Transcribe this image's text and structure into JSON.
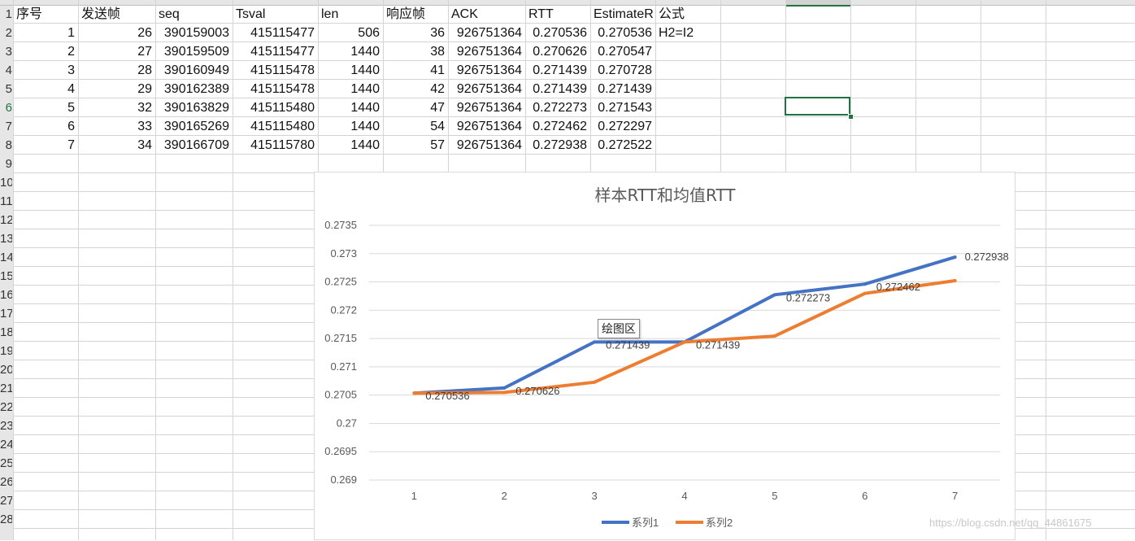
{
  "spreadsheet": {
    "row_numbers": [
      "1",
      "2",
      "3",
      "4",
      "5",
      "6",
      "7",
      "8",
      "9",
      "10",
      "11",
      "12",
      "13",
      "14",
      "15",
      "16",
      "17",
      "18",
      "19",
      "20",
      "21",
      "22",
      "23",
      "24",
      "25",
      "26",
      "27",
      "28"
    ],
    "selected_row": "6",
    "headers": [
      "序号",
      "发送帧",
      "seq",
      "Tsval",
      "len",
      "响应帧",
      "ACK",
      "RTT",
      "EstimateR",
      "公式"
    ],
    "rows": [
      [
        "1",
        "26",
        "390159003",
        "415115477",
        "506",
        "36",
        "926751364",
        "0.270536",
        "0.270536",
        "H2=I2"
      ],
      [
        "2",
        "27",
        "390159509",
        "415115477",
        "1440",
        "38",
        "926751364",
        "0.270626",
        "0.270547",
        ""
      ],
      [
        "3",
        "28",
        "390160949",
        "415115478",
        "1440",
        "41",
        "926751364",
        "0.271439",
        "0.270728",
        ""
      ],
      [
        "4",
        "29",
        "390162389",
        "415115478",
        "1440",
        "42",
        "926751364",
        "0.271439",
        "0.271439",
        ""
      ],
      [
        "5",
        "32",
        "390163829",
        "415115480",
        "1440",
        "47",
        "926751364",
        "0.272273",
        "0.271543",
        ""
      ],
      [
        "6",
        "33",
        "390165269",
        "415115480",
        "1440",
        "54",
        "926751364",
        "0.272462",
        "0.272297",
        ""
      ],
      [
        "7",
        "34",
        "390166709",
        "415115780",
        "1440",
        "57",
        "926751364",
        "0.272938",
        "0.272522",
        ""
      ]
    ]
  },
  "chart_data": {
    "type": "line",
    "title": "样本RTT和均值RTT",
    "xlabel": "",
    "ylabel": "",
    "x": [
      "1",
      "2",
      "3",
      "4",
      "5",
      "6",
      "7"
    ],
    "ylim": [
      0.269,
      0.2735
    ],
    "yticks": [
      "0.269",
      "0.2695",
      "0.27",
      "0.2705",
      "0.271",
      "0.2715",
      "0.272",
      "0.2725",
      "0.273",
      "0.2735"
    ],
    "grid": true,
    "legend_position": "bottom",
    "series": [
      {
        "name": "系列1",
        "color": "#4472c4",
        "values": [
          0.270536,
          0.270626,
          0.271439,
          0.271439,
          0.272273,
          0.272462,
          0.272938
        ],
        "data_labels": [
          "0.270536",
          "0.270626",
          "0.271439",
          "0.271439",
          "0.272273",
          "0.272462",
          "0.272938"
        ]
      },
      {
        "name": "系列2",
        "color": "#ed7d31",
        "values": [
          0.270536,
          0.270547,
          0.270728,
          0.271439,
          0.271543,
          0.272297,
          0.272522
        ],
        "data_labels": []
      }
    ]
  },
  "tooltip": {
    "text": "绘图区"
  },
  "watermark": {
    "text": "https://blog.csdn.net/qq_44861675"
  }
}
